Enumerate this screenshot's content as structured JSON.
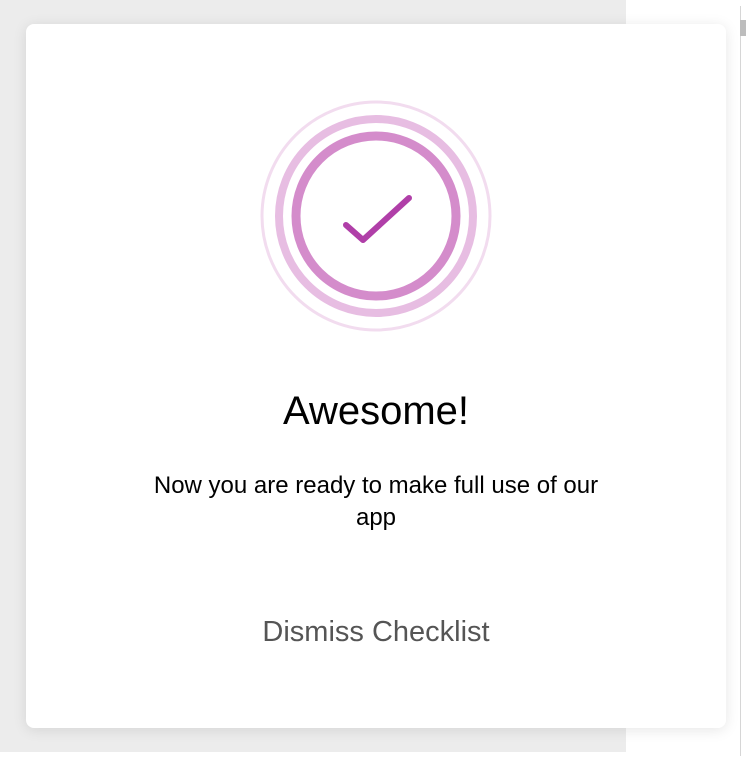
{
  "completion_dialog": {
    "title": "Awesome!",
    "message": "Now you are ready to make full use of our app",
    "dismiss_label": "Dismiss Checklist",
    "icon": "check-circle-icon"
  },
  "colors": {
    "accent": "#b03fa8",
    "ring_inner": "#d48ccb",
    "ring_middle": "#e7bde2",
    "ring_outer": "#f2dcef",
    "dismiss_text": "#555555",
    "title_text": "#000000"
  }
}
